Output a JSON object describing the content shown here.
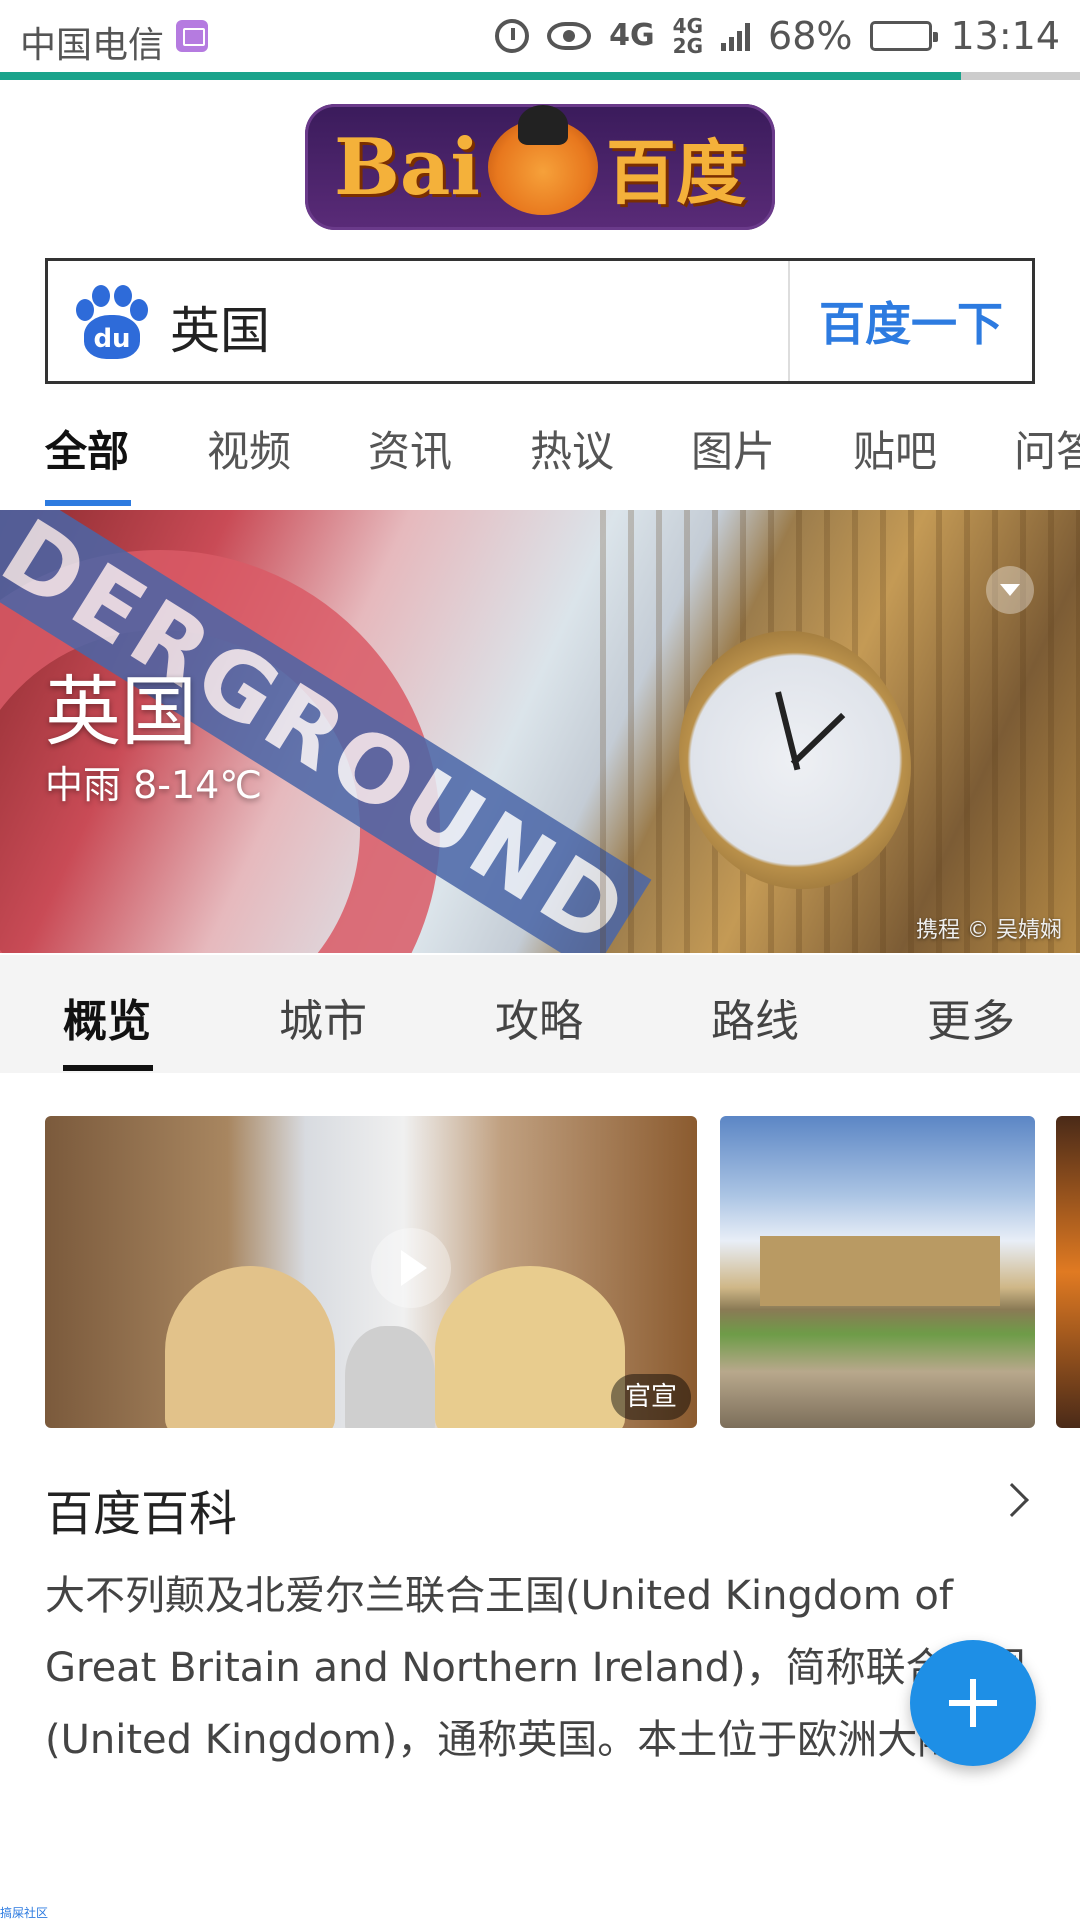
{
  "status_bar": {
    "carrier": "中国电信",
    "network": "4G",
    "network_small_top": "4G",
    "network_small_bottom": "2G",
    "battery": "68%",
    "time": "13:14"
  },
  "page_load_progress": 0.89,
  "logo": {
    "text_left": "Bai",
    "text_right": "百度"
  },
  "search": {
    "query": "英国",
    "submit_label": "百度一下",
    "paw_text": "du"
  },
  "tabs": [
    "全部",
    "视频",
    "资讯",
    "热议",
    "图片",
    "贴吧",
    "问答"
  ],
  "hero": {
    "title": "英国",
    "weather": "中雨 8-14℃",
    "credit": "携程 © 吴婧娴",
    "underground_text": "DERGROUND"
  },
  "sub_tabs": [
    "概览",
    "城市",
    "攻略",
    "路线",
    "更多"
  ],
  "media": {
    "video_badge": "官宣"
  },
  "baike": {
    "title": "百度百科",
    "text": "大不列颠及北爱尔兰联合王国(United Kingdom of Great Britain and Northern Ireland)，简称联合王国(United Kingdom)，通称英国。本土位于欧洲大陆..."
  },
  "watermark": "搞屎社区",
  "colors": {
    "accent_blue": "#2d7be0",
    "progress_green": "#1aa38b",
    "fab_blue": "#1e8fe6"
  }
}
